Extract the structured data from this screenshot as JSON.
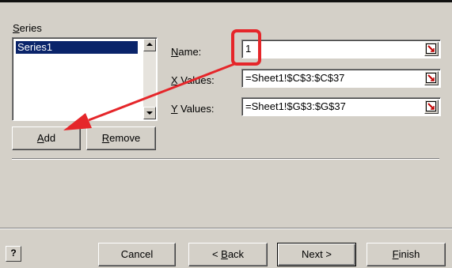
{
  "series_group": {
    "label_first": "S",
    "label_rest": "eries",
    "items": [
      "Series1"
    ],
    "add_button": {
      "key": "A",
      "rest": "dd"
    },
    "remove_button": {
      "key": "R",
      "rest": "emove"
    }
  },
  "fields": {
    "name": {
      "label_key": "N",
      "label_rest": "ame:",
      "value": "1"
    },
    "x_values": {
      "label_key": "X",
      "label_rest": " Values:",
      "value": "=Sheet1!$C$3:$C$37"
    },
    "y_values": {
      "label_key": "Y",
      "label_rest": " Values:",
      "value": "=Sheet1!$G$3:$G$37"
    }
  },
  "footer": {
    "help_label": "?",
    "cancel": "Cancel",
    "back_prefix": "< ",
    "back_key": "B",
    "back_rest": "ack",
    "next": "Next >",
    "finish_key": "F",
    "finish_rest": "inish"
  },
  "annotation": {
    "color": "#e5262a"
  }
}
